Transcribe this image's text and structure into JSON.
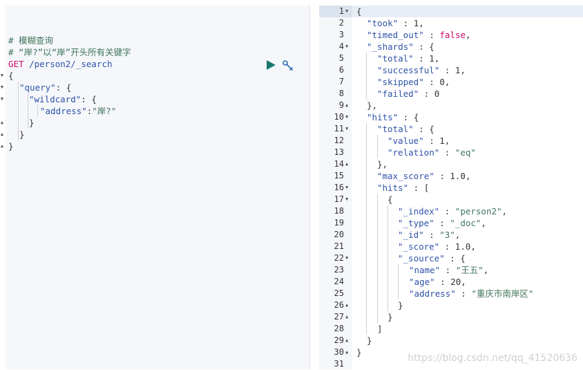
{
  "request": {
    "comment1": "# 模糊查询",
    "comment2": "# “岸?”以“岸”开头所有关键字",
    "method": "GET",
    "path": " /person2/_search",
    "open_brace": "{",
    "query_key": "\"query\"",
    "wildcard_key": "\"wildcard\"",
    "address_key": "\"address\"",
    "address_value": "\"岸?\"",
    "close_brace": "}",
    "colon_space": ": {",
    "colon": ":"
  },
  "toolbar": {
    "run_icon": "play-icon",
    "settings_icon": "wrench-icon",
    "accent_color": "#1a7a6e"
  },
  "response": {
    "line_numbers": [
      "1",
      "2",
      "3",
      "4",
      "5",
      "6",
      "7",
      "8",
      "9",
      "10",
      "11",
      "12",
      "13",
      "14",
      "15",
      "16",
      "17",
      "18",
      "19",
      "20",
      "21",
      "22",
      "23",
      "24",
      "25",
      "26",
      "27",
      "28",
      "29",
      "30",
      "31"
    ],
    "t": {
      "l1": "{",
      "took_k": "\"took\"",
      "took_v": "1",
      "timed_out_k": "\"timed_out\"",
      "timed_out_v": "false",
      "shards_k": "\"_shards\"",
      "total_k": "\"total\"",
      "total_v": "1",
      "successful_k": "\"successful\"",
      "successful_v": "1",
      "skipped_k": "\"skipped\"",
      "skipped_v": "0",
      "failed_k": "\"failed\"",
      "failed_v": "0",
      "hits_k": "\"hits\"",
      "htotal_k": "\"total\"",
      "value_k": "\"value\"",
      "value_v": "1",
      "relation_k": "\"relation\"",
      "relation_v": "\"eq\"",
      "max_score_k": "\"max_score\"",
      "max_score_v": "1.0",
      "hits2_k": "\"hits\"",
      "index_k": "\"_index\"",
      "index_v": "\"person2\"",
      "type_k": "\"_type\"",
      "type_v": "\"_doc\"",
      "id_k": "\"_id\"",
      "id_v": "\"3\"",
      "score_k": "\"_score\"",
      "score_v": "1.0",
      "source_k": "\"_source\"",
      "name_k": "\"name\"",
      "name_v": "\"王五\"",
      "age_k": "\"age\"",
      "age_v": "20",
      "address_k": "\"address\"",
      "address_v": "\"重庆市南岸区\""
    }
  },
  "watermark": "https://blog.csdn.net/qq_41520636"
}
